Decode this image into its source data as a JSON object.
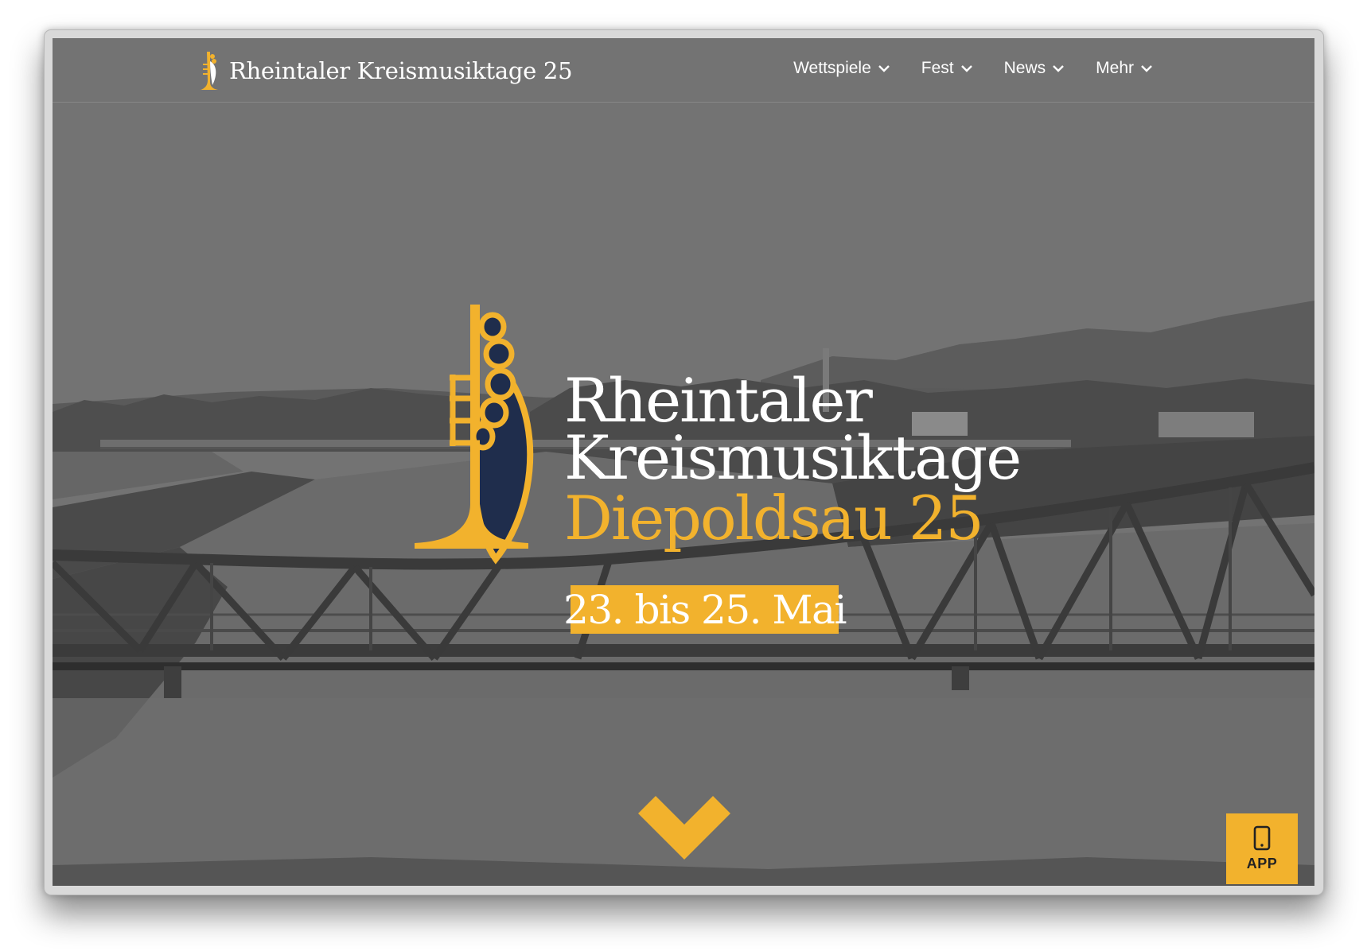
{
  "colors": {
    "accent": "#f2b22d",
    "navy": "#1f2d4c",
    "overlay": "#717171",
    "text": "#ffffff"
  },
  "header": {
    "brand_name": "Rheintaler Kreismusiktage 25",
    "nav": [
      {
        "label": "Wettspiele",
        "icon": "chevron-down-icon"
      },
      {
        "label": "Fest",
        "icon": "chevron-down-icon"
      },
      {
        "label": "News",
        "icon": "chevron-down-icon"
      },
      {
        "label": "Mehr",
        "icon": "chevron-down-icon"
      }
    ]
  },
  "hero": {
    "title_line1": "Rheintaler",
    "title_line2": "Kreismusiktage",
    "title_line3": "Diepoldsau 25",
    "date": "23. bis 25. Mai",
    "scroll_icon": "chevron-down-icon"
  },
  "app_button": {
    "label": "APP",
    "icon": "smartphone-icon"
  }
}
